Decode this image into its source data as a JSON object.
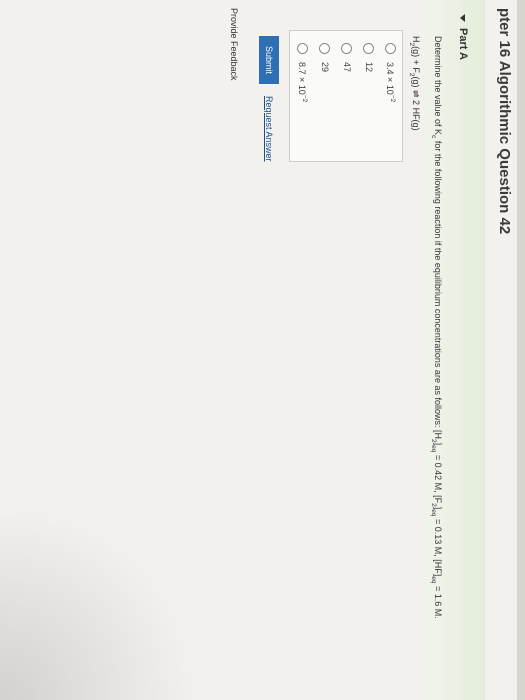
{
  "page": {
    "title": "pter 16 Algorithmic Question 42"
  },
  "part": {
    "label": "Part A"
  },
  "question": {
    "text": "Determine the value of Kc for the following reaction if the equilibrium concentrations are as follows: [H2]eq = 0.42 M, [F2]eq = 0.13 M, [HF]eq = 1.6 M.",
    "equation": "H2(g) + F2(g) ⇌ 2 HF(g)"
  },
  "answers": [
    {
      "label": "3.4 × 10-2"
    },
    {
      "label": "12"
    },
    {
      "label": "47"
    },
    {
      "label": "29"
    },
    {
      "label": "8.7 × 10-2"
    }
  ],
  "actions": {
    "submit": "Submit",
    "request_answer": "Request Answer"
  },
  "footer": {
    "feedback": "Provide Feedback"
  }
}
